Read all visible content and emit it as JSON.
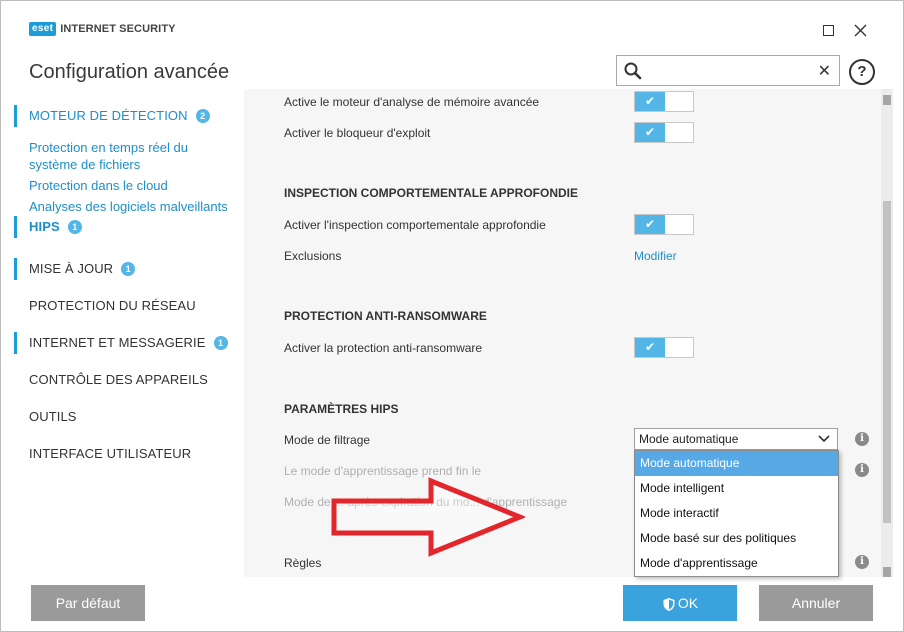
{
  "window": {
    "brand": "eset",
    "product": "INTERNET SECURITY",
    "title": "Configuration avancée",
    "search": {
      "value": "",
      "placeholder": ""
    }
  },
  "sidebar": {
    "items": [
      {
        "label": "MOTEUR DE DÉTECTION",
        "badge": "2"
      },
      {
        "label": "Protection en temps réel du système de fichiers"
      },
      {
        "label": "Protection dans le cloud"
      },
      {
        "label": "Analyses des logiciels malveillants"
      },
      {
        "label": "HIPS",
        "badge": "1"
      },
      {
        "label": "MISE À JOUR",
        "badge": "1"
      },
      {
        "label": "PROTECTION DU RÉSEAU"
      },
      {
        "label": "INTERNET ET MESSAGERIE",
        "badge": "1"
      },
      {
        "label": "CONTRÔLE DES APPAREILS"
      },
      {
        "label": "OUTILS"
      },
      {
        "label": "INTERFACE UTILISATEUR"
      }
    ]
  },
  "content": {
    "rows": {
      "memory_scan": "Active le moteur d'analyse de mémoire avancée",
      "exploit_blocker": "Activer le bloqueur d'exploit",
      "deep_inspection_title": "INSPECTION COMPORTEMENTALE APPROFONDIE",
      "deep_inspection": "Activer l'inspection comportementale approfondie",
      "exclusions": "Exclusions",
      "exclusions_link": "Modifier",
      "ransomware_title": "PROTECTION ANTI-RANSOMWARE",
      "ransomware": "Activer la protection anti-ransomware",
      "hips_title": "PARAMÈTRES HIPS",
      "filter_mode": "Mode de filtrage",
      "filter_mode_value": "Mode automatique",
      "learning_end": "Le mode d'apprentissage prend fin le",
      "mode_after_learning": "Mode de ... après expiration du mo... d'apprentissage",
      "rules": "Règles"
    },
    "toggle_check": "✔",
    "info_glyph": "i"
  },
  "dropdown": {
    "options": [
      "Mode automatique",
      "Mode intelligent",
      "Mode interactif",
      "Mode basé sur des politiques",
      "Mode d'apprentissage"
    ],
    "selected_index": 0
  },
  "footer": {
    "default_label": "Par défaut",
    "ok_label": "OK",
    "cancel_label": "Annuler"
  },
  "colors": {
    "accent": "#1d9cd8",
    "toggle_on": "#53b6e6",
    "selected_option": "#57a9e6",
    "arrow": "#e3262b"
  }
}
